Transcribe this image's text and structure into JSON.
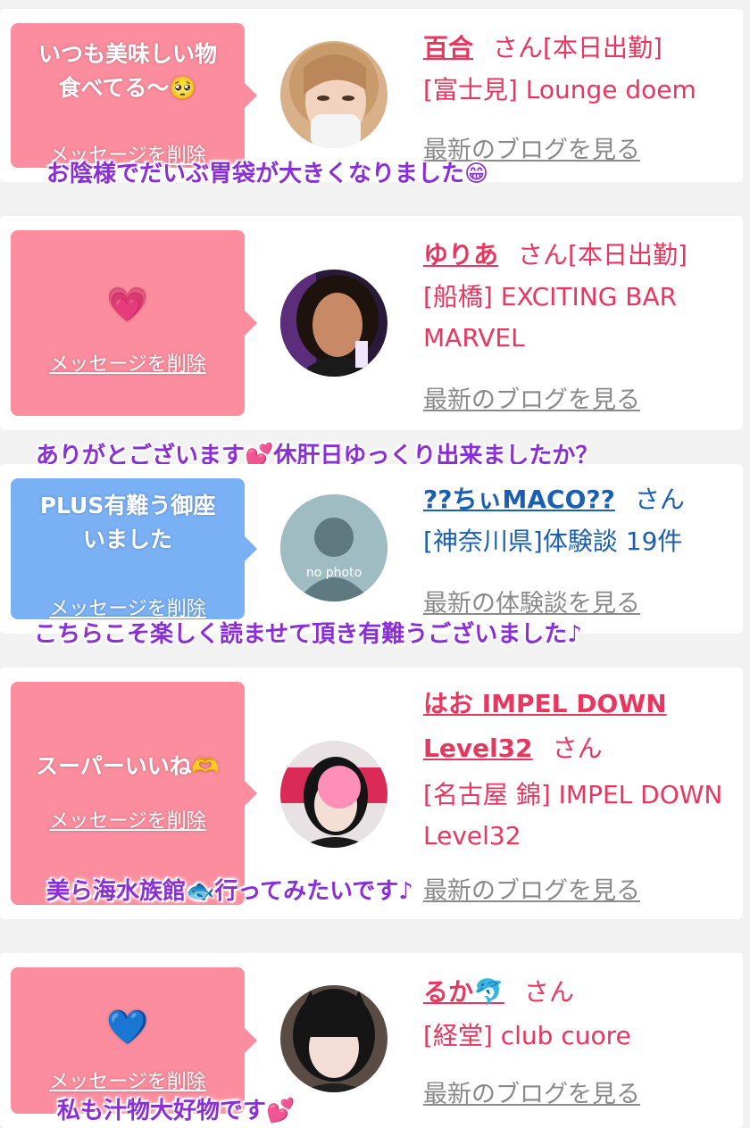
{
  "items": [
    {
      "bubble_message": "いつも美味しい物\n食べてる〜🥺",
      "bubble_color": "#fb8d9e",
      "delete_label": "メッセージを削除",
      "name": "百合",
      "honorific": "さん",
      "status": "[本日出勤]",
      "shop": "[富士見] Lounge doem",
      "latest_link": "最新のブログを見る",
      "reply": "お陰様でだいぶ胃袋が大きくなりました😁"
    },
    {
      "bubble_message": "💗",
      "bubble_color": "#fb8d9e",
      "delete_label": "メッセージを削除",
      "name": "ゆりあ",
      "honorific": "さん",
      "status": "[本日出勤]",
      "shop": "[船橋] EXCITING BAR MARVEL",
      "latest_link": "最新のブログを見る",
      "reply": "ありがとございます💕休肝日ゆっくり出来ましたか？"
    },
    {
      "bubble_message": "PLUS有難う御座\nいました",
      "bubble_color": "#7ab0f4",
      "delete_label": "メッセージを削除",
      "name": "??ちぃMACO??",
      "honorific": "さん",
      "shop": "[神奈川県]体験談 19件",
      "avatar_text": "no photo",
      "latest_link": "最新の体験談を見る",
      "reply": "こちらこそ楽しく読ませて頂き有難うございました♪"
    },
    {
      "bubble_message": "スーパーいいね🫶",
      "bubble_color": "#fb8d9e",
      "delete_label": "メッセージを削除",
      "name": "はお IMPEL DOWN Level32",
      "honorific": "さん",
      "shop": "[名古屋 錦] IMPEL DOWN Level32",
      "latest_link": "最新のブログを見る",
      "reply": "美ら海水族館🐟行ってみたいです♪"
    },
    {
      "bubble_message": "💙",
      "bubble_color": "#fb8d9e",
      "delete_label": "メッセージを削除",
      "name": "るか🐬",
      "honorific": "さん",
      "shop": "[経堂] club cuore",
      "latest_link": "最新のブログを見る",
      "reply": "私も汁物大好物です💕"
    }
  ]
}
